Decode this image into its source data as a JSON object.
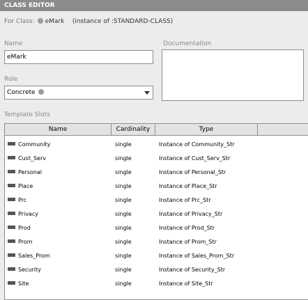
{
  "window": {
    "title": "CLASS EDITOR"
  },
  "for_class": {
    "label": "For Class:",
    "class_name": "eMark",
    "instance_of": "(instance of :STANDARD-CLASS)"
  },
  "name_section": {
    "label": "Name",
    "value": "eMark"
  },
  "documentation_section": {
    "label": "Documentation",
    "value": ""
  },
  "role_section": {
    "label": "Role",
    "selected": "Concrete"
  },
  "template_slots": {
    "label": "Template Slots",
    "columns": [
      "Name",
      "Cardinality",
      "Type"
    ],
    "rows": [
      {
        "name": "Community",
        "cardinality": "single",
        "type": "Instance of Community_Str"
      },
      {
        "name": "Cust_Serv",
        "cardinality": "single",
        "type": "Instance of Cust_Serv_Str"
      },
      {
        "name": "Personal",
        "cardinality": "single",
        "type": "Instance of Personal_Str"
      },
      {
        "name": "Place",
        "cardinality": "single",
        "type": "Instance of Place_Str"
      },
      {
        "name": "Prc",
        "cardinality": "single",
        "type": "Instance of Prc_Str"
      },
      {
        "name": "Privacy",
        "cardinality": "single",
        "type": "Instance of Privacy_Str"
      },
      {
        "name": "Prod",
        "cardinality": "single",
        "type": "Instance of Prod_Str"
      },
      {
        "name": "Prom",
        "cardinality": "single",
        "type": "Instance of Prom_Str"
      },
      {
        "name": "Sales_Prom",
        "cardinality": "single",
        "type": "Instance of Sales_Prom_Str"
      },
      {
        "name": "Security",
        "cardinality": "single",
        "type": "Instance of Security_Str"
      },
      {
        "name": "Site",
        "cardinality": "single",
        "type": "Instance of Site_Str"
      }
    ]
  },
  "icons": {
    "class_marker": "circle-icon",
    "slot_marker": "slot-icon",
    "dropdown": "chevron-down-icon"
  },
  "colors": {
    "title_bar": "#8b8b8b",
    "panel_bg": "#ececec",
    "header_bg": "#e3e3e3",
    "border": "#8d8d8d"
  }
}
